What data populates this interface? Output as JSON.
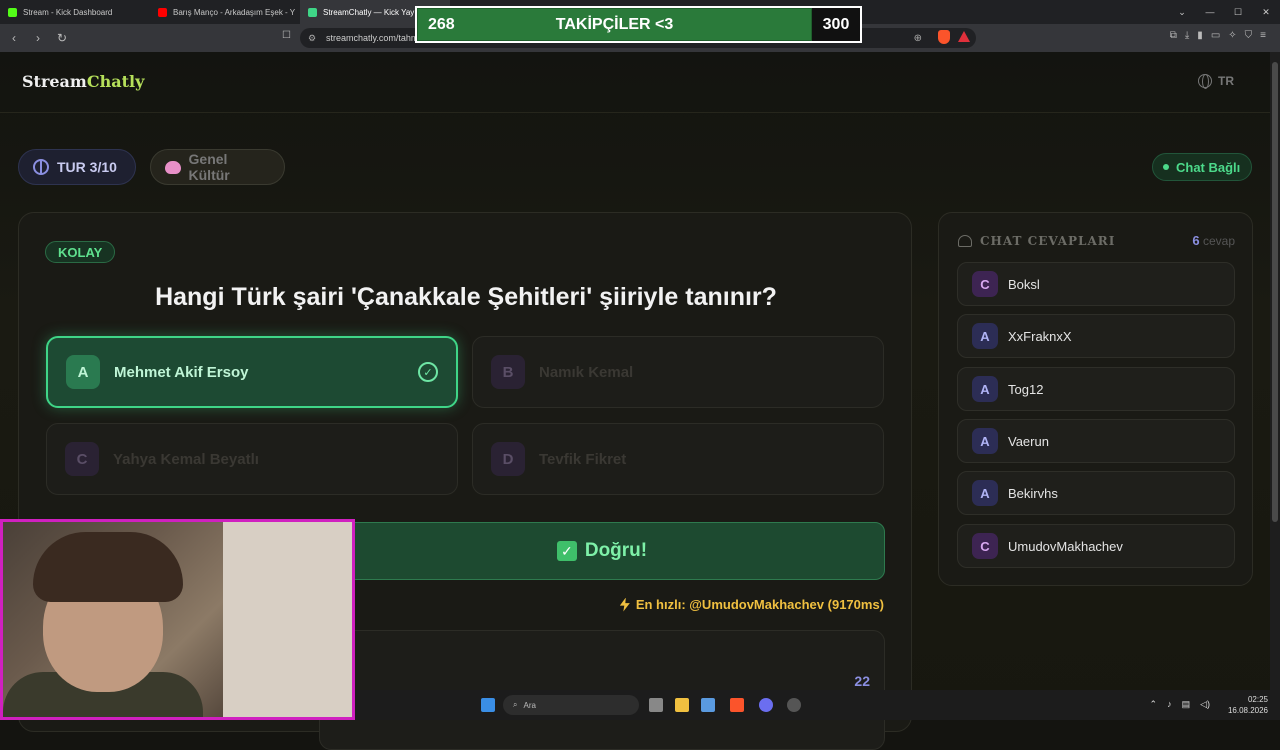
{
  "browser": {
    "tabs": [
      {
        "label": "Stream - Kick Dashboard",
        "fav_color": "#53fc18"
      },
      {
        "label": "Barış Manço - Arkadaşım Eşek - Y",
        "fav_color": "#ff0000"
      },
      {
        "label": "StreamChatly — Kick Yay",
        "fav_color": "#3fd587"
      }
    ],
    "url": "streamchatly.com/tahm"
  },
  "overlay": {
    "current": "268",
    "title": "TAKİPÇİLER <3",
    "target": "300"
  },
  "app": {
    "logo_a": "Stream",
    "logo_b": "Chatly",
    "lang": "TR",
    "round": "TUR 3/10",
    "category": "Genel Kültür",
    "chat_status": "Chat Bağlı"
  },
  "question": {
    "difficulty": "KOLAY",
    "text": "Hangi Türk şairi 'Çanakkale Şehitleri' şiiriyle tanınır?",
    "options": [
      {
        "letter": "A",
        "text": "Mehmet Akif Ersoy"
      },
      {
        "letter": "B",
        "text": "Namık Kemal"
      },
      {
        "letter": "C",
        "text": "Yahya Kemal Beyatlı"
      },
      {
        "letter": "D",
        "text": "Tevfik Fikret"
      }
    ],
    "result": "Doğru!",
    "fastest": "En hızlı: @UmudovMakhachev (9170ms)",
    "lower_number": "22"
  },
  "chat": {
    "title": "CHAT CEVAPLARI",
    "count": "6",
    "count_suffix": "cevap",
    "answers": [
      {
        "letter": "C",
        "name": "Boksl"
      },
      {
        "letter": "A",
        "name": "XxFraknxX"
      },
      {
        "letter": "A",
        "name": "Tog12"
      },
      {
        "letter": "A",
        "name": "Vaerun"
      },
      {
        "letter": "A",
        "name": "Bekirvhs"
      },
      {
        "letter": "C",
        "name": "UmudovMakhachev"
      }
    ]
  },
  "taskbar": {
    "search_placeholder": "Ara",
    "time": "02:25",
    "date": "16.08.2026"
  }
}
